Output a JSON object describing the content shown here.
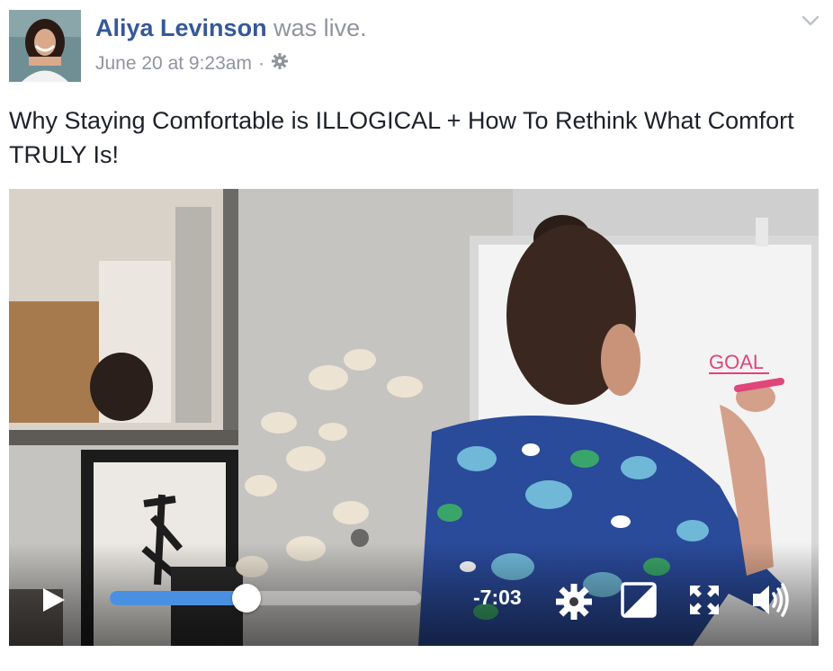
{
  "post": {
    "author": "Aliya Levinson",
    "status": "was live.",
    "date": "June 20 at 9:23am",
    "separator": "·",
    "title": "Why Staying Comfortable is ILLOGICAL + How To Rethink What Comfort TRULY Is!"
  },
  "video": {
    "time_remaining": "-7:03",
    "progress_fraction": 0.44,
    "whiteboard_text": "GOAL"
  },
  "icons": {
    "privacy": "gear-icon",
    "menu": "chevron-down-icon",
    "play": "play-icon",
    "settings": "settings-icon",
    "popout": "picture-in-picture-icon",
    "fullscreen": "fullscreen-icon",
    "volume": "volume-icon"
  },
  "colors": {
    "author": "#365899",
    "meta": "#90949c",
    "progress": "#4a90e2"
  }
}
